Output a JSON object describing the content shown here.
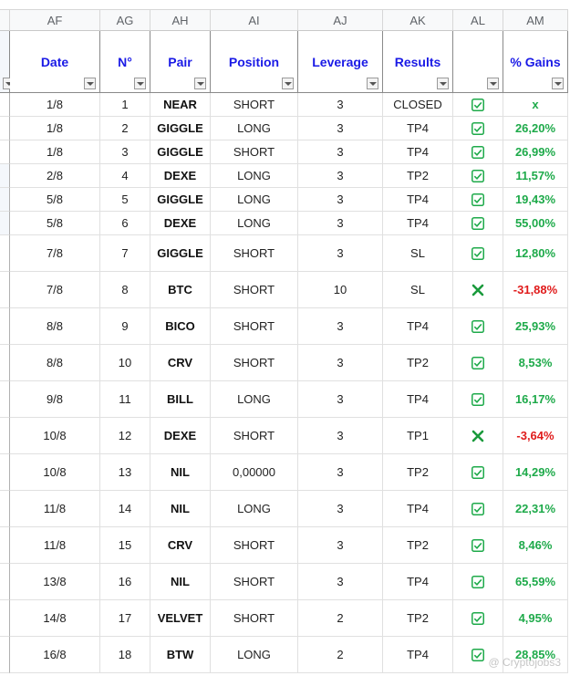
{
  "columns": [
    "AF",
    "AG",
    "AH",
    "AI",
    "AJ",
    "AK",
    "AL",
    "AM"
  ],
  "headers": [
    "Date",
    "N°",
    "Pair",
    "Position",
    "Leverage",
    "Results",
    "",
    "% Gains"
  ],
  "rows": [
    {
      "date": "1/8",
      "n": "1",
      "pair": "NEAR",
      "position": "SHORT",
      "leverage": "3",
      "result": "CLOSED",
      "status": "check",
      "gain": "x",
      "sign": "pos"
    },
    {
      "date": "1/8",
      "n": "2",
      "pair": "GIGGLE",
      "position": "LONG",
      "leverage": "3",
      "result": "TP4",
      "status": "check",
      "gain": "26,20%",
      "sign": "pos"
    },
    {
      "date": "1/8",
      "n": "3",
      "pair": "GIGGLE",
      "position": "SHORT",
      "leverage": "3",
      "result": "TP4",
      "status": "check",
      "gain": "26,99%",
      "sign": "pos"
    },
    {
      "date": "2/8",
      "n": "4",
      "pair": "DEXE",
      "position": "LONG",
      "leverage": "3",
      "result": "TP2",
      "status": "check",
      "gain": "11,57%",
      "sign": "pos"
    },
    {
      "date": "5/8",
      "n": "5",
      "pair": "GIGGLE",
      "position": "LONG",
      "leverage": "3",
      "result": "TP4",
      "status": "check",
      "gain": "19,43%",
      "sign": "pos"
    },
    {
      "date": "5/8",
      "n": "6",
      "pair": "DEXE",
      "position": "LONG",
      "leverage": "3",
      "result": "TP4",
      "status": "check",
      "gain": "55,00%",
      "sign": "pos"
    },
    {
      "date": "7/8",
      "n": "7",
      "pair": "GIGGLE",
      "position": "SHORT",
      "leverage": "3",
      "result": "SL",
      "status": "check",
      "gain": "12,80%",
      "sign": "pos"
    },
    {
      "date": "7/8",
      "n": "8",
      "pair": "BTC",
      "position": "SHORT",
      "leverage": "10",
      "result": "SL",
      "status": "cross",
      "gain": "-31,88%",
      "sign": "neg"
    },
    {
      "date": "8/8",
      "n": "9",
      "pair": "BICO",
      "position": "SHORT",
      "leverage": "3",
      "result": "TP4",
      "status": "check",
      "gain": "25,93%",
      "sign": "pos"
    },
    {
      "date": "8/8",
      "n": "10",
      "pair": "CRV",
      "position": "SHORT",
      "leverage": "3",
      "result": "TP2",
      "status": "check",
      "gain": "8,53%",
      "sign": "pos"
    },
    {
      "date": "9/8",
      "n": "11",
      "pair": "BILL",
      "position": "LONG",
      "leverage": "3",
      "result": "TP4",
      "status": "check",
      "gain": "16,17%",
      "sign": "pos"
    },
    {
      "date": "10/8",
      "n": "12",
      "pair": "DEXE",
      "position": "SHORT",
      "leverage": "3",
      "result": "TP1",
      "status": "cross",
      "gain": "-3,64%",
      "sign": "neg"
    },
    {
      "date": "10/8",
      "n": "13",
      "pair": "NIL",
      "position": "0,00000",
      "leverage": "3",
      "result": "TP2",
      "status": "check",
      "gain": "14,29%",
      "sign": "pos"
    },
    {
      "date": "11/8",
      "n": "14",
      "pair": "NIL",
      "position": "LONG",
      "leverage": "3",
      "result": "TP4",
      "status": "check",
      "gain": "22,31%",
      "sign": "pos"
    },
    {
      "date": "11/8",
      "n": "15",
      "pair": "CRV",
      "position": "SHORT",
      "leverage": "3",
      "result": "TP2",
      "status": "check",
      "gain": "8,46%",
      "sign": "pos"
    },
    {
      "date": "13/8",
      "n": "16",
      "pair": "NIL",
      "position": "SHORT",
      "leverage": "3",
      "result": "TP4",
      "status": "check",
      "gain": "65,59%",
      "sign": "pos"
    },
    {
      "date": "14/8",
      "n": "17",
      "pair": "VELVET",
      "position": "SHORT",
      "leverage": "2",
      "result": "TP2",
      "status": "check",
      "gain": "4,95%",
      "sign": "pos"
    },
    {
      "date": "16/8",
      "n": "18",
      "pair": "BTW",
      "position": "LONG",
      "leverage": "2",
      "result": "TP4",
      "status": "check",
      "gain": "28,85%",
      "sign": "pos"
    }
  ],
  "watermark": "@ Cryptojobs3",
  "colors": {
    "header_text": "#1a1ae6",
    "gain_pos": "#1eaa4a",
    "gain_neg": "#e01b1b",
    "check_green": "#1eaa4a"
  },
  "icons": {
    "check": "checkbox-checked-icon",
    "cross": "cross-icon",
    "filter": "filter-dropdown-icon"
  }
}
